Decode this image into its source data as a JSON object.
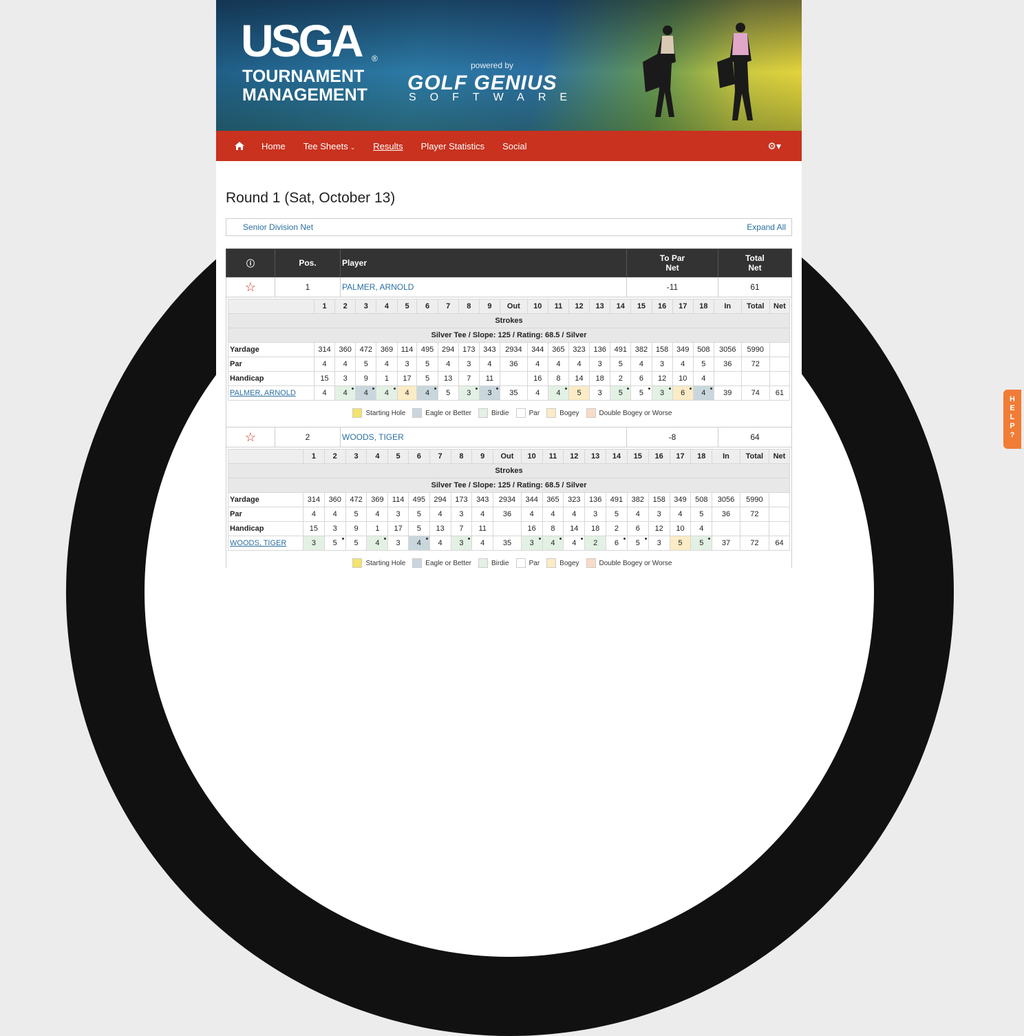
{
  "banner": {
    "usga": "USGA",
    "registered": "®",
    "tm_line1": "TOURNAMENT",
    "tm_line2": "MANAGEMENT",
    "powered_by": "powered by",
    "golf_genius": "GOLF GENIUS",
    "software": "SOFTWARE"
  },
  "nav": {
    "items": [
      {
        "label": "Home"
      },
      {
        "label": "Tee Sheets"
      },
      {
        "label": "Results"
      },
      {
        "label": "Player Statistics"
      },
      {
        "label": "Social"
      }
    ],
    "tee_sheets_caret": "⌄",
    "gear_icon": "gear-icon"
  },
  "round_title": "Round 1 (Sat, October 13)",
  "division": {
    "name": "Senior Division Net",
    "expand": "Expand All"
  },
  "results_headers": {
    "info": "i",
    "pos": "Pos.",
    "player": "Player",
    "to_par_1": "To Par",
    "to_par_2": "Net",
    "total_1": "Total",
    "total_2": "Net"
  },
  "holes_header": [
    "",
    "1",
    "2",
    "3",
    "4",
    "5",
    "6",
    "7",
    "8",
    "9",
    "Out",
    "10",
    "11",
    "12",
    "13",
    "14",
    "15",
    "16",
    "17",
    "18",
    "In",
    "Total",
    "Net"
  ],
  "scorecard_labels": {
    "strokes": "Strokes",
    "tee_info": "Silver Tee / Slope: 125 / Rating: 68.5 / Silver",
    "yardage": "Yardage",
    "par": "Par",
    "handicap": "Handicap"
  },
  "yardage": [
    "314",
    "360",
    "472",
    "369",
    "114",
    "495",
    "294",
    "173",
    "343",
    "2934",
    "344",
    "365",
    "323",
    "136",
    "491",
    "382",
    "158",
    "349",
    "508",
    "3056",
    "5990",
    ""
  ],
  "par": [
    "4",
    "4",
    "5",
    "4",
    "3",
    "5",
    "4",
    "3",
    "4",
    "36",
    "4",
    "4",
    "4",
    "3",
    "5",
    "4",
    "3",
    "4",
    "5",
    "36",
    "72",
    ""
  ],
  "handicap": [
    "15",
    "3",
    "9",
    "1",
    "17",
    "5",
    "13",
    "7",
    "11",
    "",
    "16",
    "8",
    "14",
    "18",
    "2",
    "6",
    "12",
    "10",
    "4",
    "",
    "",
    ""
  ],
  "legend": [
    {
      "label": "Starting Hole",
      "key": "start"
    },
    {
      "label": "Eagle or Better",
      "key": "eagle"
    },
    {
      "label": "Birdie",
      "key": "birdie"
    },
    {
      "label": "Par",
      "key": "par"
    },
    {
      "label": "Bogey",
      "key": "bogey"
    },
    {
      "label": "Double Bogey or Worse",
      "key": "double"
    }
  ],
  "players": [
    {
      "pos": "1",
      "name": "PALMER, ARNOLD",
      "to_par": "-11",
      "total": "61",
      "scores": [
        "4",
        "4",
        "4",
        "4",
        "4",
        "4",
        "5",
        "3",
        "3",
        "35",
        "4",
        "4",
        "5",
        "3",
        "5",
        "5",
        "3",
        "6",
        "4",
        "39",
        "74",
        "61"
      ],
      "classes": [
        "",
        "s-birdie dot",
        "s-eagle dot",
        "s-birdie dot",
        "s-bogey",
        "s-eagle dot",
        "",
        "s-birdie dot",
        "s-eagle dot",
        "",
        "",
        "s-birdie dot",
        "s-bogey",
        "",
        "s-birdie dot",
        "dot",
        "s-birdie dot",
        "s-bogey dot",
        "s-eagle dot",
        "",
        "",
        ""
      ]
    },
    {
      "pos": "2",
      "name": "WOODS, TIGER",
      "to_par": "-8",
      "total": "64",
      "scores": [
        "3",
        "5",
        "5",
        "4",
        "3",
        "4",
        "4",
        "3",
        "4",
        "35",
        "3",
        "4",
        "4",
        "2",
        "6",
        "5",
        "3",
        "5",
        "5",
        "37",
        "72",
        "64"
      ],
      "classes": [
        "s-birdie",
        "dot",
        "",
        "s-birdie dot",
        "",
        "s-eagle dot",
        "",
        "s-birdie dot",
        "",
        "",
        "s-birdie dot",
        "s-birdie dot",
        "dot",
        "s-birdie",
        "dot",
        "dot",
        "",
        "s-bogey",
        "s-birdie dot",
        "",
        "",
        ""
      ]
    }
  ],
  "help": "HELP"
}
